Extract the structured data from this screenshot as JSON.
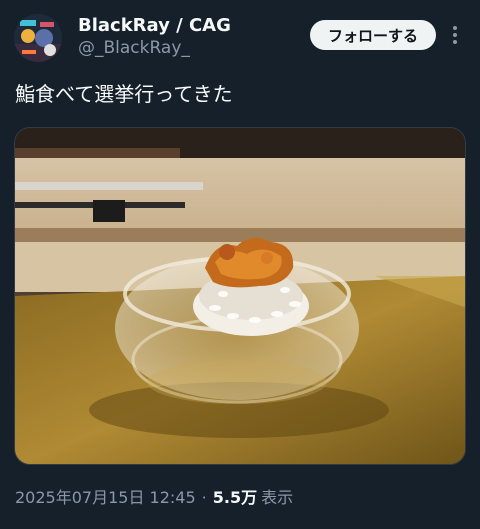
{
  "user": {
    "display_name": "BlackRay / CAG",
    "handle": "@_BlackRay_"
  },
  "actions": {
    "follow_label": "フォローする"
  },
  "tweet": {
    "text": "鮨食べて選挙行ってきた",
    "timestamp": "2025年07月15日 12:45",
    "separator": "·",
    "views_count": "5.5万",
    "views_label": "表示"
  },
  "icons": {
    "more": "more-vertical-icon"
  },
  "colors": {
    "background": "#15202b",
    "text_primary": "#f7f9f9",
    "text_secondary": "#8b98a5",
    "button_bg": "#eff3f4"
  }
}
